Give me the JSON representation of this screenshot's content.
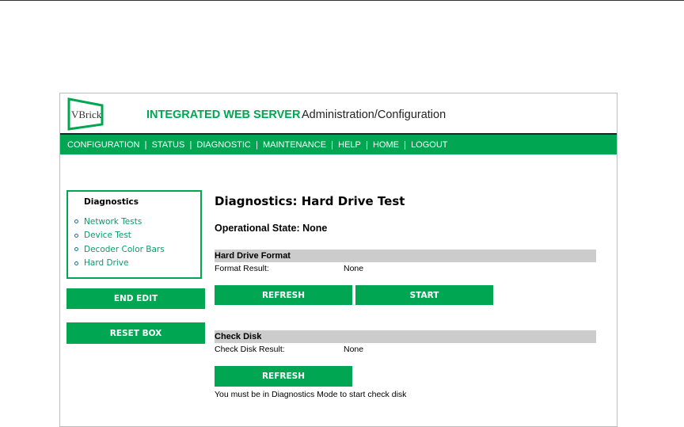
{
  "header": {
    "logo_text": "VBrick",
    "title": "INTEGRATED WEB SERVER",
    "subtitle": "Administration/Configuration"
  },
  "nav": [
    "CONFIGURATION",
    "STATUS",
    "DIAGNOSTIC",
    "MAINTENANCE",
    "HELP",
    "HOME",
    "LOGOUT"
  ],
  "sidebar": {
    "heading": "Diagnostics",
    "items": [
      "Network Tests",
      "Device Test",
      "Decoder Color Bars",
      "Hard Drive"
    ],
    "end_edit": "END EDIT",
    "reset_box": "RESET BOX"
  },
  "main": {
    "title": "Diagnostics: Hard Drive Test",
    "op_state": "Operational State: None",
    "format": {
      "heading": "Hard Drive Format",
      "label": "Format Result:",
      "value": "None",
      "refresh": "REFRESH",
      "start": "START"
    },
    "check": {
      "heading": "Check Disk",
      "label": "Check Disk Result:",
      "value": "None",
      "refresh": "REFRESH",
      "message": "You must be in Diagnostics Mode to start check disk"
    }
  },
  "colors": {
    "accent": "#00a651"
  }
}
